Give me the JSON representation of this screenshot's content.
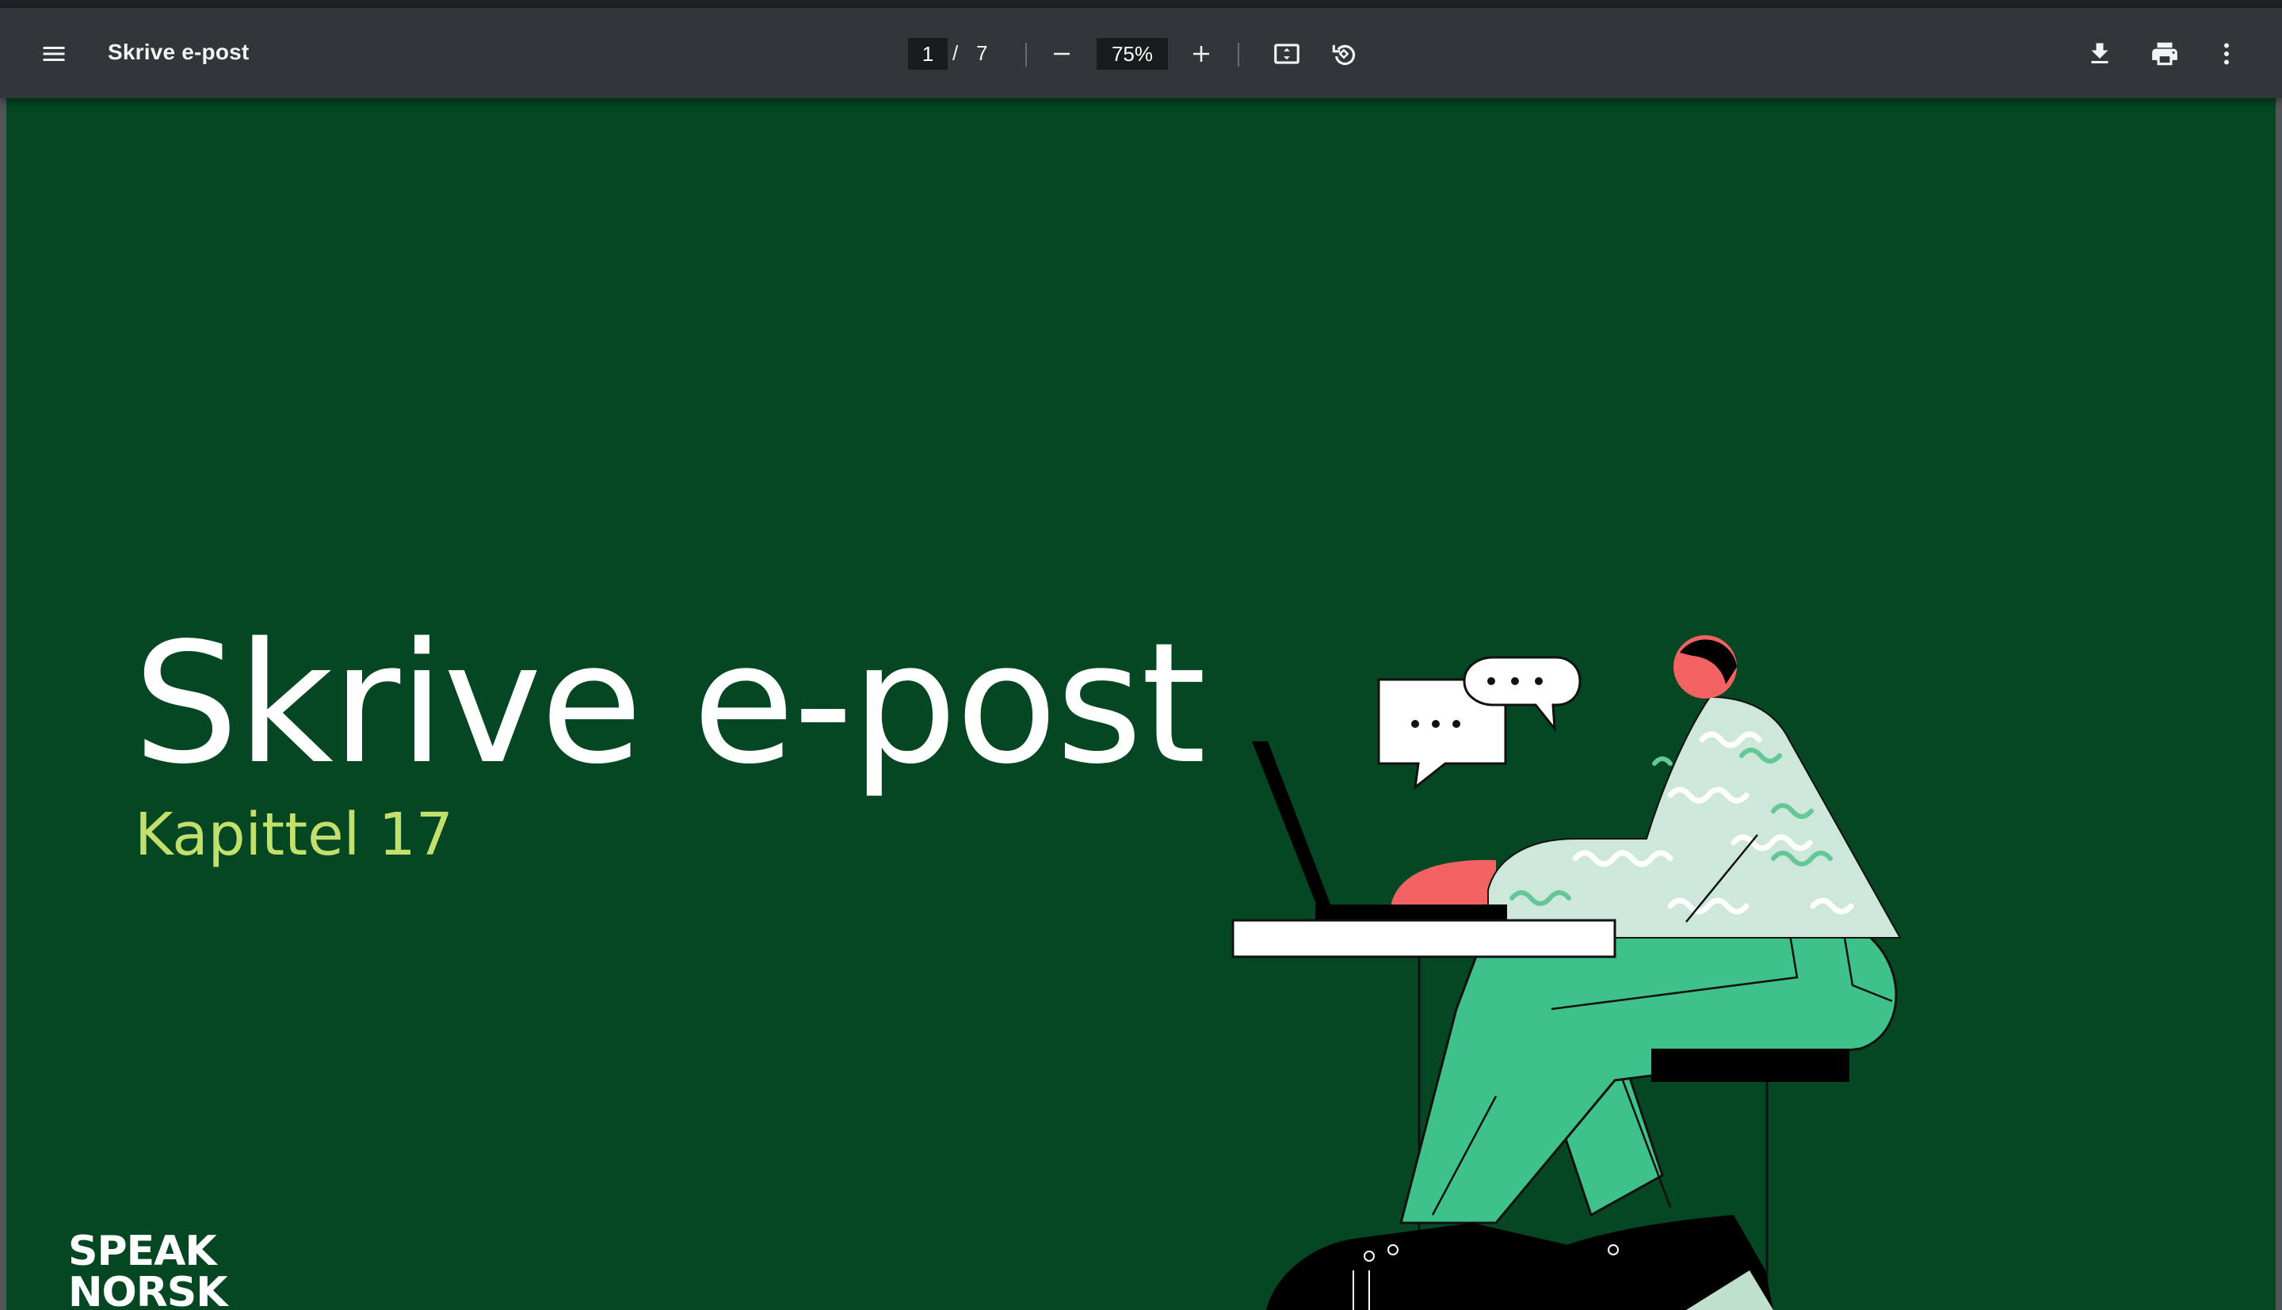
{
  "viewer": {
    "document_title": "Skrive e-post",
    "current_page": "1",
    "page_separator": "/",
    "total_pages": "7",
    "zoom": "75%"
  },
  "icons": {
    "menu": "menu-icon",
    "zoom_out": "minus-icon",
    "zoom_in": "plus-icon",
    "fit_page": "fit-to-page-icon",
    "rotate": "rotate-icon",
    "download": "download-icon",
    "print": "print-icon",
    "more": "more-vert-icon"
  },
  "page": {
    "title": "Skrive e-post",
    "subtitle": "Kapittel 17",
    "logo_line1": "SPEAK",
    "logo_line2": "NORSK",
    "background_color": "#044722",
    "subtitle_color": "#c2e06b"
  }
}
